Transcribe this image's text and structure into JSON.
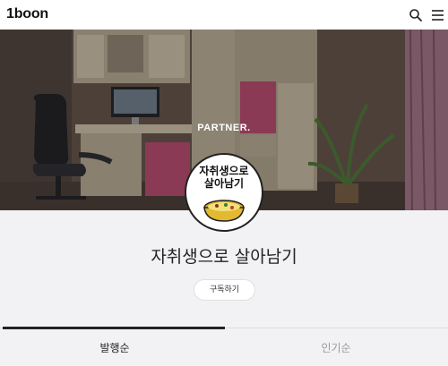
{
  "header": {
    "logo": "1boon",
    "search_icon": "search-icon",
    "menu_icon": "hamburger-menu-icon"
  },
  "cover": {
    "badge": "PARTNER."
  },
  "profile": {
    "avatar_line1": "자취생으로",
    "avatar_line2": "살아남기",
    "channel_name": "자취생으로 살아남기",
    "subscribe_label": "구독하기"
  },
  "tabs": [
    {
      "label": "발행순",
      "active": true
    },
    {
      "label": "인기순",
      "active": false
    }
  ],
  "colors": {
    "accent": "#222222",
    "inactive_tab": "#999999",
    "cabinet_pink": "#c2436f"
  }
}
